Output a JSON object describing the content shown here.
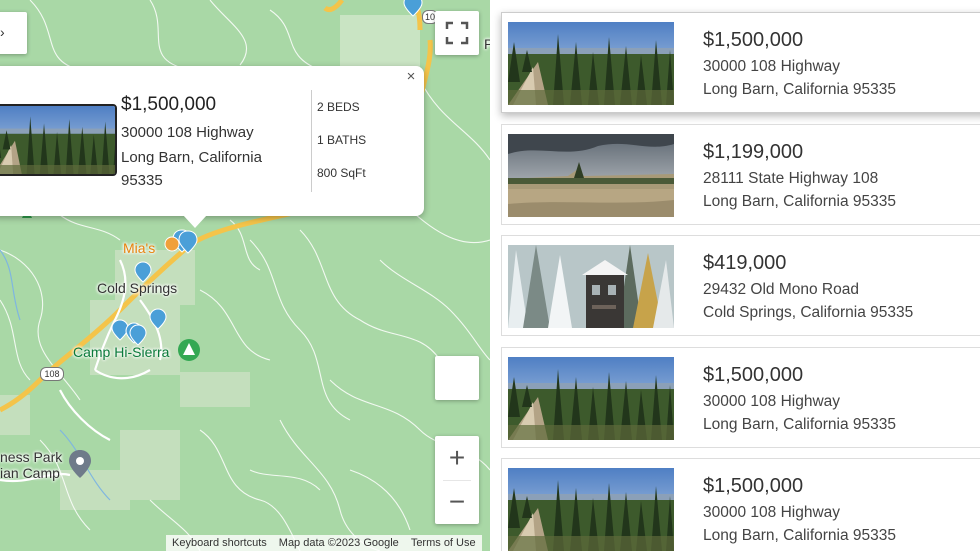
{
  "map": {
    "labels": {
      "mias": "Mia's",
      "cold_springs": "Cold Springs",
      "camp_hi_sierra": "Camp Hi-Sierra",
      "ness_park": "ness Park",
      "ian_camp": "ian Camp",
      "route_108": "108",
      "route_108_top": "10",
      "edge_letter": "P"
    },
    "fullscreen_icon": "fullscreen-icon",
    "zoom_in": "+",
    "zoom_out": "−",
    "attribution": {
      "keyboard": "Keyboard shortcuts",
      "map_data": "Map data ©2023 Google",
      "terms": "Terms of Use"
    },
    "colors": {
      "land": "#a9d8a6",
      "road": "#f4c44a",
      "pin": "#4a9fd8"
    }
  },
  "info_window": {
    "price": "$1,500,000",
    "street": "30000 108 Highway",
    "city": "Long Barn, California 95335",
    "beds": "2 BEDS",
    "baths": "1 BATHS",
    "sqft": "800 SqFt",
    "close": "×"
  },
  "listings": [
    {
      "price": "$1,500,000",
      "street": "30000 108 Highway",
      "city": "Long Barn, California 95335",
      "photo": "forest-aerial"
    },
    {
      "price": "$1,199,000",
      "street": "28111 State Highway 108",
      "city": "Long Barn, California 95335",
      "photo": "cleared-lot"
    },
    {
      "price": "$419,000",
      "street": "29432 Old Mono Road",
      "city": "Cold Springs, California 95335",
      "photo": "snow-cabin"
    },
    {
      "price": "$1,500,000",
      "street": "30000 108 Highway",
      "city": "Long Barn, California 95335",
      "photo": "forest-aerial"
    },
    {
      "price": "$1,500,000",
      "street": "30000 108 Highway",
      "city": "Long Barn, California 95335",
      "photo": "forest-aerial"
    }
  ]
}
